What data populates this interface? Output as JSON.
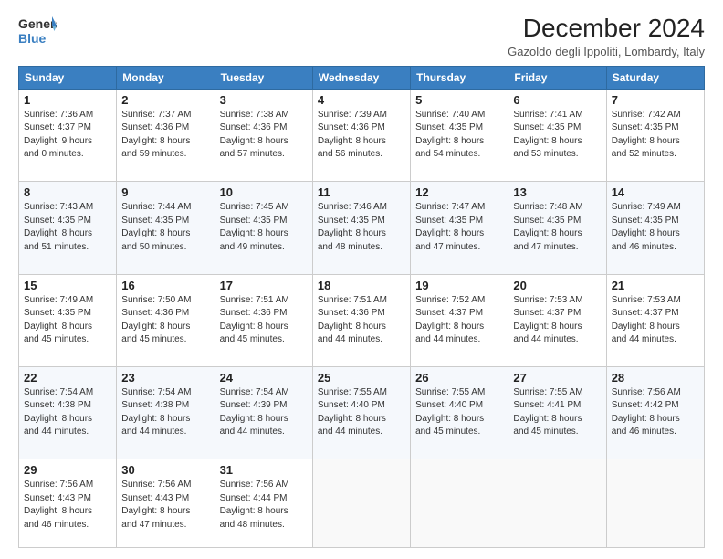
{
  "logo": {
    "line1": "General",
    "line2": "Blue"
  },
  "title": "December 2024",
  "subtitle": "Gazoldo degli Ippoliti, Lombardy, Italy",
  "days_of_week": [
    "Sunday",
    "Monday",
    "Tuesday",
    "Wednesday",
    "Thursday",
    "Friday",
    "Saturday"
  ],
  "weeks": [
    [
      {
        "num": "1",
        "info": "Sunrise: 7:36 AM\nSunset: 4:37 PM\nDaylight: 9 hours\nand 0 minutes."
      },
      {
        "num": "2",
        "info": "Sunrise: 7:37 AM\nSunset: 4:36 PM\nDaylight: 8 hours\nand 59 minutes."
      },
      {
        "num": "3",
        "info": "Sunrise: 7:38 AM\nSunset: 4:36 PM\nDaylight: 8 hours\nand 57 minutes."
      },
      {
        "num": "4",
        "info": "Sunrise: 7:39 AM\nSunset: 4:36 PM\nDaylight: 8 hours\nand 56 minutes."
      },
      {
        "num": "5",
        "info": "Sunrise: 7:40 AM\nSunset: 4:35 PM\nDaylight: 8 hours\nand 54 minutes."
      },
      {
        "num": "6",
        "info": "Sunrise: 7:41 AM\nSunset: 4:35 PM\nDaylight: 8 hours\nand 53 minutes."
      },
      {
        "num": "7",
        "info": "Sunrise: 7:42 AM\nSunset: 4:35 PM\nDaylight: 8 hours\nand 52 minutes."
      }
    ],
    [
      {
        "num": "8",
        "info": "Sunrise: 7:43 AM\nSunset: 4:35 PM\nDaylight: 8 hours\nand 51 minutes."
      },
      {
        "num": "9",
        "info": "Sunrise: 7:44 AM\nSunset: 4:35 PM\nDaylight: 8 hours\nand 50 minutes."
      },
      {
        "num": "10",
        "info": "Sunrise: 7:45 AM\nSunset: 4:35 PM\nDaylight: 8 hours\nand 49 minutes."
      },
      {
        "num": "11",
        "info": "Sunrise: 7:46 AM\nSunset: 4:35 PM\nDaylight: 8 hours\nand 48 minutes."
      },
      {
        "num": "12",
        "info": "Sunrise: 7:47 AM\nSunset: 4:35 PM\nDaylight: 8 hours\nand 47 minutes."
      },
      {
        "num": "13",
        "info": "Sunrise: 7:48 AM\nSunset: 4:35 PM\nDaylight: 8 hours\nand 47 minutes."
      },
      {
        "num": "14",
        "info": "Sunrise: 7:49 AM\nSunset: 4:35 PM\nDaylight: 8 hours\nand 46 minutes."
      }
    ],
    [
      {
        "num": "15",
        "info": "Sunrise: 7:49 AM\nSunset: 4:35 PM\nDaylight: 8 hours\nand 45 minutes."
      },
      {
        "num": "16",
        "info": "Sunrise: 7:50 AM\nSunset: 4:36 PM\nDaylight: 8 hours\nand 45 minutes."
      },
      {
        "num": "17",
        "info": "Sunrise: 7:51 AM\nSunset: 4:36 PM\nDaylight: 8 hours\nand 45 minutes."
      },
      {
        "num": "18",
        "info": "Sunrise: 7:51 AM\nSunset: 4:36 PM\nDaylight: 8 hours\nand 44 minutes."
      },
      {
        "num": "19",
        "info": "Sunrise: 7:52 AM\nSunset: 4:37 PM\nDaylight: 8 hours\nand 44 minutes."
      },
      {
        "num": "20",
        "info": "Sunrise: 7:53 AM\nSunset: 4:37 PM\nDaylight: 8 hours\nand 44 minutes."
      },
      {
        "num": "21",
        "info": "Sunrise: 7:53 AM\nSunset: 4:37 PM\nDaylight: 8 hours\nand 44 minutes."
      }
    ],
    [
      {
        "num": "22",
        "info": "Sunrise: 7:54 AM\nSunset: 4:38 PM\nDaylight: 8 hours\nand 44 minutes."
      },
      {
        "num": "23",
        "info": "Sunrise: 7:54 AM\nSunset: 4:38 PM\nDaylight: 8 hours\nand 44 minutes."
      },
      {
        "num": "24",
        "info": "Sunrise: 7:54 AM\nSunset: 4:39 PM\nDaylight: 8 hours\nand 44 minutes."
      },
      {
        "num": "25",
        "info": "Sunrise: 7:55 AM\nSunset: 4:40 PM\nDaylight: 8 hours\nand 44 minutes."
      },
      {
        "num": "26",
        "info": "Sunrise: 7:55 AM\nSunset: 4:40 PM\nDaylight: 8 hours\nand 45 minutes."
      },
      {
        "num": "27",
        "info": "Sunrise: 7:55 AM\nSunset: 4:41 PM\nDaylight: 8 hours\nand 45 minutes."
      },
      {
        "num": "28",
        "info": "Sunrise: 7:56 AM\nSunset: 4:42 PM\nDaylight: 8 hours\nand 46 minutes."
      }
    ],
    [
      {
        "num": "29",
        "info": "Sunrise: 7:56 AM\nSunset: 4:43 PM\nDaylight: 8 hours\nand 46 minutes."
      },
      {
        "num": "30",
        "info": "Sunrise: 7:56 AM\nSunset: 4:43 PM\nDaylight: 8 hours\nand 47 minutes."
      },
      {
        "num": "31",
        "info": "Sunrise: 7:56 AM\nSunset: 4:44 PM\nDaylight: 8 hours\nand 48 minutes."
      },
      null,
      null,
      null,
      null
    ]
  ]
}
